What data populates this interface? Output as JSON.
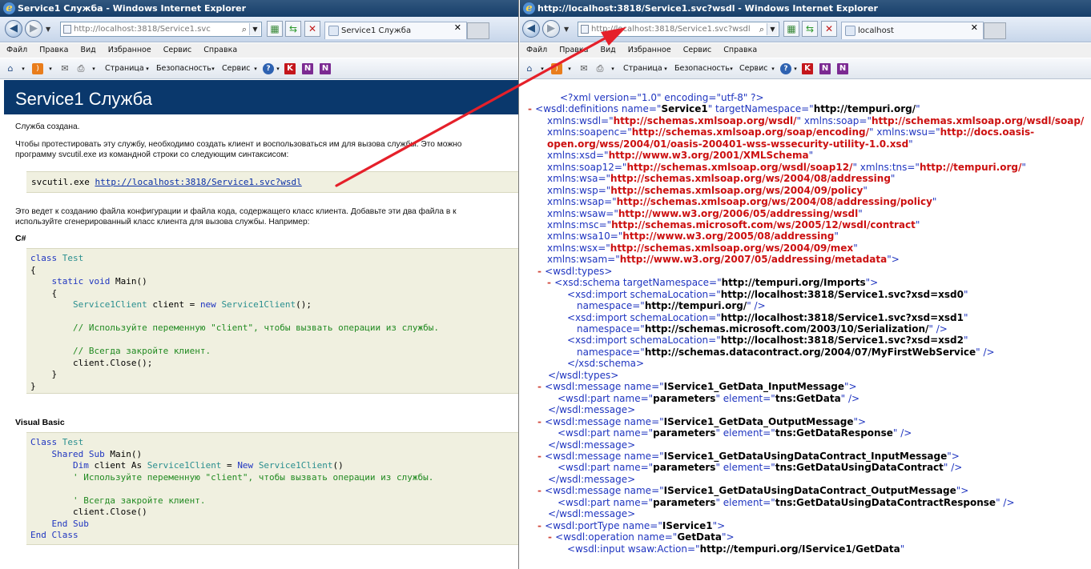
{
  "left_window": {
    "title": "Service1 Служба - Windows Internet Explorer",
    "address": "http://localhost:3818/Service1.svc",
    "tab_label": "Service1 Служба",
    "menu": [
      "Файл",
      "Правка",
      "Вид",
      "Избранное",
      "Сервис",
      "Справка"
    ],
    "commands": {
      "page": "Страница",
      "safety": "Безопасность",
      "tools": "Сервис"
    },
    "content": {
      "heading": "Service1 Служба",
      "p1": "Служба создана.",
      "p2_line1": "Чтобы протестировать эту службу, необходимо создать клиент и воспользоваться им для вызова службы. Это можно",
      "p2_line2": "программу svcutil.exe из командной строки со следующим синтаксисом:",
      "svcutil_cmd": "svcutil.exe ",
      "svcutil_link": "http://localhost:3818/Service1.svc?wsdl",
      "p3_line1": "Это ведет к созданию файла конфигурации и файла кода, содержащего класс клиента. Добавьте эти два файла в к",
      "p3_line2": "используйте сгенерированный класс клиента для вызова службы. Например:",
      "csharp_heading": "C#",
      "vb_heading": "Visual Basic",
      "cs": {
        "class_kw": "class",
        "class_name": "Test",
        "open": "{",
        "static_void": "static void",
        "main": "Main()",
        "open2": "{",
        "client_type": "Service1Client",
        "client_decl": " client = ",
        "new_kw": "new",
        "client_ctor": "Service1Client",
        "ctor_end": "();",
        "comment1": "// Используйте переменную \"client\", чтобы вызвать операции из службы.",
        "comment2": "// Всегда закройте клиент.",
        "close_call": "client.Close();",
        "close2": "}",
        "close1": "}"
      },
      "vb": {
        "class_kw": "Class",
        "class_name": "Test",
        "shared_sub": "Shared Sub",
        "main": " Main()",
        "dim_kw": "Dim",
        "dim_rest": " client As ",
        "client_type": "Service1Client",
        "eq": " = ",
        "new_kw": "New",
        "client_ctor": "Service1Client",
        "ctor_end": "()",
        "comment1": "' Используйте переменную \"client\", чтобы вызвать операции из службы.",
        "comment2": "' Всегда закройте клиент.",
        "close_call": "client.Close()",
        "end_sub": "End Sub",
        "end_class": "End Class"
      }
    }
  },
  "right_window": {
    "title": "http://localhost:3818/Service1.svc?wsdl - Windows Internet Explorer",
    "address": "http://localhost:3818/Service1.svc?wsdl",
    "tab_label": "localhost",
    "menu": [
      "Файл",
      "Правка",
      "Вид",
      "Избранное",
      "Сервис",
      "Справка"
    ],
    "commands": {
      "page": "Страница",
      "safety": "Безопасность",
      "tools": "Сервис"
    },
    "xml": [
      {
        "pi": "<?xml version=\"1.0\" encoding=\"utf-8\" ?>"
      },
      {
        "m": "- ",
        "pre": "<wsdl:definitions name=\"",
        "v": "Service1",
        "mid": "\" targetNamespace=\"",
        "v2": "http://tempuri.org/",
        "post": "\""
      },
      {
        "pre": "xmlns:wsdl=\"",
        "r": "http://schemas.xmlsoap.org/wsdl/",
        "mid": "\" xmlns:soap=\"",
        "r2": "http://schemas.xmlsoap.org/wsdl/soap/"
      },
      {
        "pre": "xmlns:soapenc=\"",
        "r": "http://schemas.xmlsoap.org/soap/encoding/",
        "mid": "\" xmlns:wsu=\"",
        "r2": "http://docs.oasis-"
      },
      {
        "r": "open.org/wss/2004/01/oasis-200401-wss-wssecurity-utility-1.0.xsd",
        "post": "\""
      },
      {
        "pre": "xmlns:xsd=\"",
        "r": "http://www.w3.org/2001/XMLSchema",
        "post": "\""
      },
      {
        "pre": "xmlns:soap12=\"",
        "r": "http://schemas.xmlsoap.org/wsdl/soap12/",
        "mid": "\" xmlns:tns=\"",
        "r2": "http://tempuri.org/",
        "post": "\""
      },
      {
        "pre": "xmlns:wsa=\"",
        "r": "http://schemas.xmlsoap.org/ws/2004/08/addressing",
        "post": "\""
      },
      {
        "pre": "xmlns:wsp=\"",
        "r": "http://schemas.xmlsoap.org/ws/2004/09/policy",
        "post": "\""
      },
      {
        "pre": "xmlns:wsap=\"",
        "r": "http://schemas.xmlsoap.org/ws/2004/08/addressing/policy",
        "post": "\""
      },
      {
        "pre": "xmlns:wsaw=\"",
        "r": "http://www.w3.org/2006/05/addressing/wsdl",
        "post": "\""
      },
      {
        "pre": "xmlns:msc=\"",
        "r": "http://schemas.microsoft.com/ws/2005/12/wsdl/contract",
        "post": "\""
      },
      {
        "pre": "xmlns:wsa10=\"",
        "r": "http://www.w3.org/2005/08/addressing",
        "post": "\""
      },
      {
        "pre": "xmlns:wsx=\"",
        "r": "http://schemas.xmlsoap.org/ws/2004/09/mex",
        "post": "\""
      },
      {
        "pre": "xmlns:wsam=\"",
        "r": "http://www.w3.org/2007/05/addressing/metadata",
        "post": "\">"
      },
      {
        "m": "- ",
        "pre": "<wsdl:types>"
      },
      {
        "m": "- ",
        "pre": "<xsd:schema targetNamespace=\"",
        "v": "http://tempuri.org/Imports",
        "post": "\">"
      },
      {
        "pre": "<xsd:import schemaLocation=\"",
        "v": "http://localhost:3818/Service1.svc?xsd=xsd0",
        "post": "\""
      },
      {
        "pre": "namespace=\"",
        "v": "http://tempuri.org/",
        "post": "\" />"
      },
      {
        "pre": "<xsd:import schemaLocation=\"",
        "v": "http://localhost:3818/Service1.svc?xsd=xsd1",
        "post": "\""
      },
      {
        "pre": "namespace=\"",
        "v": "http://schemas.microsoft.com/2003/10/Serialization/",
        "post": "\" />"
      },
      {
        "pre": "<xsd:import schemaLocation=\"",
        "v": "http://localhost:3818/Service1.svc?xsd=xsd2",
        "post": "\""
      },
      {
        "pre": "namespace=\"",
        "v": "http://schemas.datacontract.org/2004/07/MyFirstWebService",
        "post": "\" />"
      },
      {
        "pre": "</xsd:schema>"
      },
      {
        "pre": "</wsdl:types>"
      },
      {
        "m": "- ",
        "pre": "<wsdl:message name=\"",
        "v": "IService1_GetData_InputMessage",
        "post": "\">"
      },
      {
        "pre": "<wsdl:part name=\"",
        "v": "parameters",
        "mid": "\" element=\"",
        "v2": "tns:GetData",
        "post": "\" />"
      },
      {
        "pre": "</wsdl:message>"
      },
      {
        "m": "- ",
        "pre": "<wsdl:message name=\"",
        "v": "IService1_GetData_OutputMessage",
        "post": "\">"
      },
      {
        "pre": "<wsdl:part name=\"",
        "v": "parameters",
        "mid": "\" element=\"",
        "v2": "tns:GetDataResponse",
        "post": "\" />"
      },
      {
        "pre": "</wsdl:message>"
      },
      {
        "m": "- ",
        "pre": "<wsdl:message name=\"",
        "v": "IService1_GetDataUsingDataContract_InputMessage",
        "post": "\">"
      },
      {
        "pre": "<wsdl:part name=\"",
        "v": "parameters",
        "mid": "\" element=\"",
        "v2": "tns:GetDataUsingDataContract",
        "post": "\" />"
      },
      {
        "pre": "</wsdl:message>"
      },
      {
        "m": "- ",
        "pre": "<wsdl:message name=\"",
        "v": "IService1_GetDataUsingDataContract_OutputMessage",
        "post": "\">"
      },
      {
        "pre": "<wsdl:part name=\"",
        "v": "parameters",
        "mid": "\" element=\"",
        "v2": "tns:GetDataUsingDataContractResponse",
        "post": "\" />"
      },
      {
        "pre": "</wsdl:message>"
      },
      {
        "m": "- ",
        "pre": "<wsdl:portType name=\"",
        "v": "IService1",
        "post": "\">"
      },
      {
        "m": "- ",
        "pre": "<wsdl:operation name=\"",
        "v": "GetData",
        "post": "\">"
      },
      {
        "pre": "<wsdl:input wsaw:Action=\"",
        "v": "http://tempuri.org/IService1/GetData",
        "post": "\""
      }
    ]
  },
  "colors": {
    "header_bg": "#0a386c",
    "code_bg": "#f0f0e0",
    "annotation_arrow": "#e5202a",
    "xml_tag": "#1f35c0",
    "xml_attr": "#8d1612",
    "xml_ns_value": "#cc1010"
  }
}
